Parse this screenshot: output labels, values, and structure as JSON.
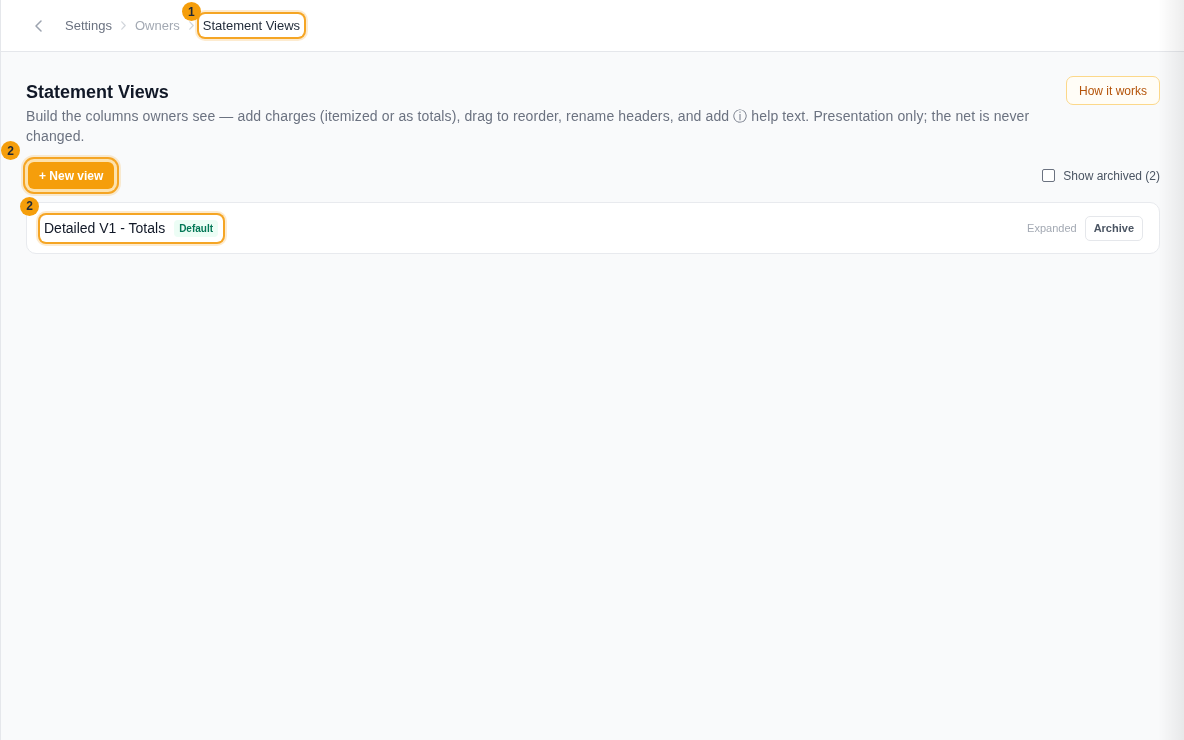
{
  "breadcrumbs": [
    {
      "label": "Settings",
      "muted": false,
      "current": false
    },
    {
      "label": "Owners",
      "muted": true,
      "current": false
    },
    {
      "label": "Statement Views",
      "muted": false,
      "current": true,
      "callout": "1"
    }
  ],
  "page": {
    "title": "Statement Views",
    "description": "Build the columns owners see — add charges (itemized or as totals), drag to reorder, rename headers, and add ⓘ help text. Presentation only; the net is never changed.",
    "help_button": "How it works"
  },
  "toolbar": {
    "new_view_button": {
      "label": "+ New view",
      "callout": "2"
    },
    "show_archived": {
      "label": "Show archived (2)",
      "checked": false
    }
  },
  "views": [
    {
      "name": "Detailed V1 - Totals",
      "default": true,
      "default_label": "Default",
      "mode": "Expanded",
      "archive_button": "Archive",
      "callout": "2"
    }
  ]
}
